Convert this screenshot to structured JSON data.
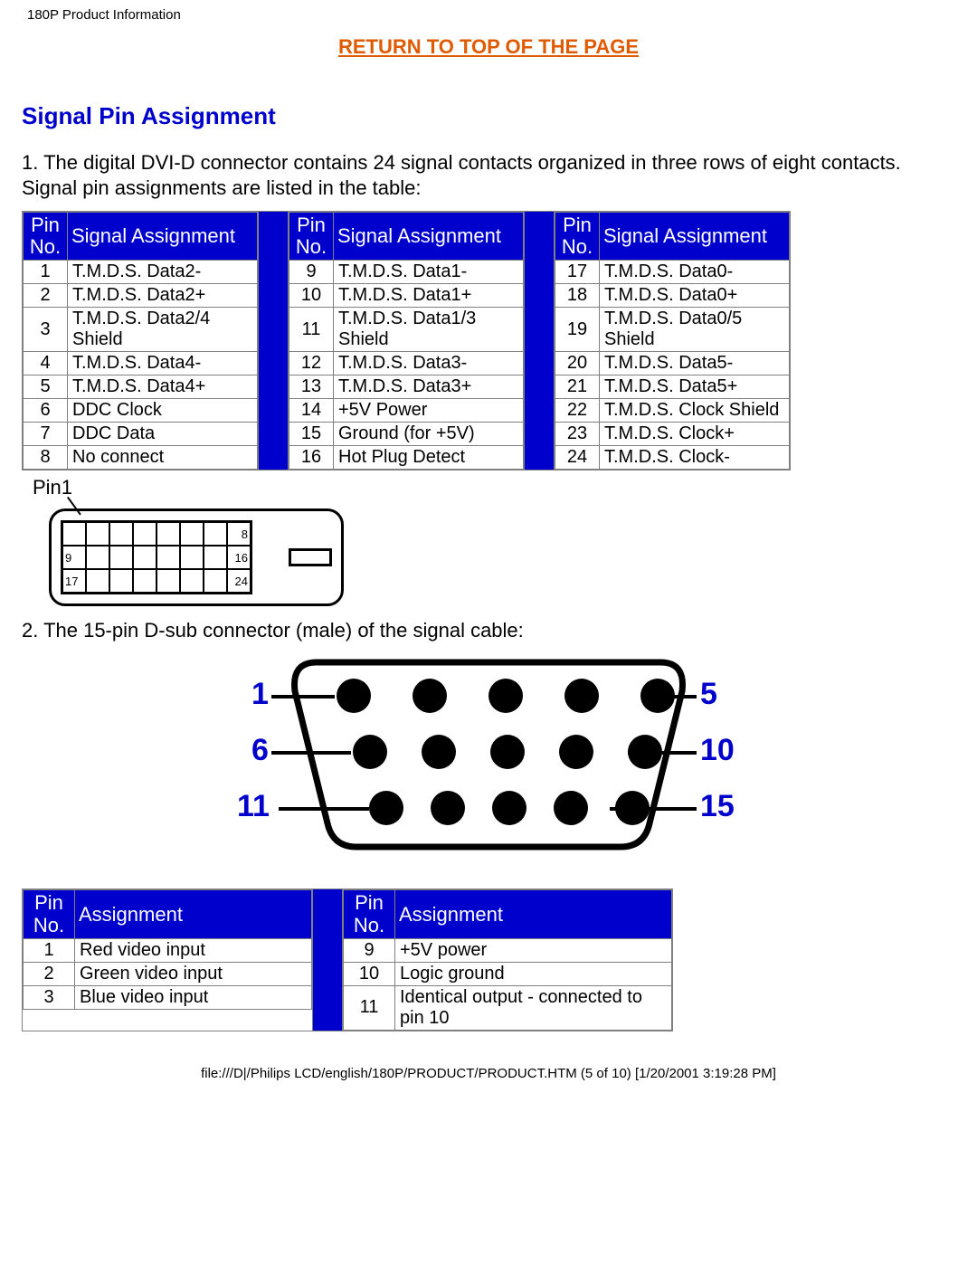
{
  "header": "180P Product Information",
  "top_link": "RETURN TO TOP OF THE PAGE",
  "section_heading": "Signal Pin Assignment",
  "intro": "1. The digital DVI-D connector contains 24 signal contacts organized in three rows of eight contacts. Signal pin assignments are listed in the table:",
  "dvi_headers": {
    "pin": "Pin No.",
    "signal": "Signal Assignment"
  },
  "dvi": [
    [
      {
        "no": "1",
        "sig": "T.M.D.S. Data2-"
      },
      {
        "no": "2",
        "sig": "T.M.D.S. Data2+"
      },
      {
        "no": "3",
        "sig": "T.M.D.S. Data2/4 Shield"
      },
      {
        "no": "4",
        "sig": "T.M.D.S. Data4-"
      },
      {
        "no": "5",
        "sig": "T.M.D.S. Data4+"
      },
      {
        "no": "6",
        "sig": "DDC Clock"
      },
      {
        "no": "7",
        "sig": "DDC Data"
      },
      {
        "no": "8",
        "sig": "No connect"
      }
    ],
    [
      {
        "no": "9",
        "sig": "T.M.D.S. Data1-"
      },
      {
        "no": "10",
        "sig": "T.M.D.S. Data1+"
      },
      {
        "no": "11",
        "sig": "T.M.D.S. Data1/3 Shield"
      },
      {
        "no": "12",
        "sig": "T.M.D.S. Data3-"
      },
      {
        "no": "13",
        "sig": "T.M.D.S. Data3+"
      },
      {
        "no": "14",
        "sig": "+5V Power"
      },
      {
        "no": "15",
        "sig": "Ground (for +5V)"
      },
      {
        "no": "16",
        "sig": "Hot Plug Detect"
      }
    ],
    [
      {
        "no": "17",
        "sig": "T.M.D.S. Data0-"
      },
      {
        "no": "18",
        "sig": "T.M.D.S. Data0+"
      },
      {
        "no": "19",
        "sig": "T.M.D.S. Data0/5 Shield"
      },
      {
        "no": "20",
        "sig": "T.M.D.S. Data5-"
      },
      {
        "no": "21",
        "sig": "T.M.D.S. Data5+"
      },
      {
        "no": "22",
        "sig": "T.M.D.S. Clock Shield"
      },
      {
        "no": "23",
        "sig": "T.M.D.S. Clock+"
      },
      {
        "no": "24",
        "sig": "T.M.D.S. Clock-"
      }
    ]
  ],
  "dvi_fig": {
    "pin1": "Pin1",
    "row_end": [
      "8",
      "16",
      "24"
    ],
    "row_start": [
      "9",
      "17"
    ]
  },
  "dsub_caption": "2. The 15-pin D-sub connector (male) of the signal cable:",
  "dsub_labels": {
    "l1": "1",
    "l2": "6",
    "l3": "11",
    "r1": "5",
    "r2": "10",
    "r3": "15"
  },
  "dsub_headers": {
    "pin": "Pin No.",
    "assign": "Assignment"
  },
  "dsub": [
    [
      {
        "no": "1",
        "a": "Red video input"
      },
      {
        "no": "2",
        "a": "Green video input"
      },
      {
        "no": "3",
        "a": "Blue video input"
      }
    ],
    [
      {
        "no": "9",
        "a": "+5V power"
      },
      {
        "no": "10",
        "a": "Logic ground"
      },
      {
        "no": "11",
        "a": "Identical output - connected to pin 10"
      }
    ]
  ],
  "footer": "file:///D|/Philips LCD/english/180P/PRODUCT/PRODUCT.HTM (5 of 10) [1/20/2001 3:19:28 PM]"
}
